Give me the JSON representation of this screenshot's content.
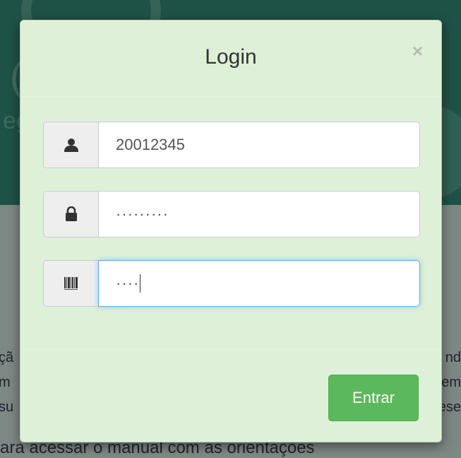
{
  "modal": {
    "title": "Login",
    "close_label": "×",
    "fields": {
      "user": {
        "icon": "user-icon",
        "value": "20012345"
      },
      "password": {
        "icon": "lock-icon",
        "display": "·········"
      },
      "code": {
        "icon": "barcode-icon",
        "display": "····"
      }
    },
    "submit_label": "Entrar",
    "colors": {
      "modal_bg": "#dff0d8",
      "submit_bg": "#5cb85c",
      "focus_border": "#66afe9"
    }
  },
  "background": {
    "left_fragments": [
      "çã",
      "m",
      "su"
    ],
    "right_fragments": [
      "nd",
      "em",
      "ese"
    ],
    "bottom_text": "ara acessar o manual com as orientações",
    "header_fragment": "eg"
  }
}
